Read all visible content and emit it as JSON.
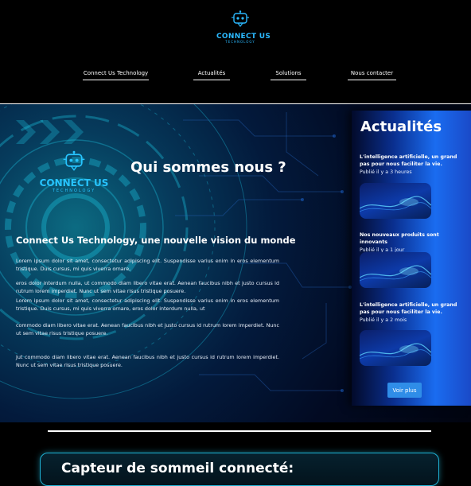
{
  "header": {
    "brand": "CONNECT US",
    "brand_sub": "TECHNOLOGY"
  },
  "nav": {
    "items": [
      {
        "label": "Connect Us Technology"
      },
      {
        "label": "Actualités"
      },
      {
        "label": "Solutions"
      },
      {
        "label": "Nous contacter"
      }
    ]
  },
  "hero": {
    "logo_brand": "CONNECT US",
    "logo_sub": "TECHNOLOGY",
    "title": "Qui sommes nous ?",
    "subtitle": "Connect Us Technology, une nouvelle vision du monde",
    "paragraphs": [
      "Lorem ipsum dolor sit amet, consectetur adipiscing elit. Suspendisse varius enim in eros elementum tristique. Duis cursus, mi quis viverra ornare,",
      "eros dolor interdum nulla, ut commodo diam libero vitae erat. Aenean faucibus nibh et justo cursus id rutrum lorem imperdiet. Nunc ut sem vitae risus tristique posuere.",
      "Lorem ipsum dolor sit amet, consectetur adipiscing elit. Suspendisse varius enim in eros elementum tristique. Duis cursus, mi quis viverra ornare, eros dolor interdum nulla, ut",
      "commodo diam libero vitae erat. Aenean faucibus nibh et justo cursus id rutrum lorem imperdiet. Nunc ut sem vitae risus tristique posuere.",
      "Jut commodo diam libero vitae erat. Aenean faucibus nibh et justo cursus id rutrum lorem imperdiet. Nunc ut sem vitae risus tristique posuere."
    ]
  },
  "sidebar": {
    "heading": "Actualités",
    "news": [
      {
        "title": "L'intelligence artificielle, un grand pas pour nous faciliter la vie.",
        "time": "Publié il y a 3 heures"
      },
      {
        "title": "Nos nouveaux produits sont innovants",
        "time": "Publié il y a 1 jour"
      },
      {
        "title": "L'intelligence artificielle, un grand pas pour nous faciliter la vie.",
        "time": "Publié il y a 2 mois"
      }
    ],
    "more_label": "Voir plus"
  },
  "card": {
    "title": "Capteur de sommeil connecté:"
  },
  "colors": {
    "accent": "#2bb9ff",
    "sidebar_blue": "#1a6cf0",
    "button": "#2f8de8",
    "card_border": "#1fb3d6"
  }
}
